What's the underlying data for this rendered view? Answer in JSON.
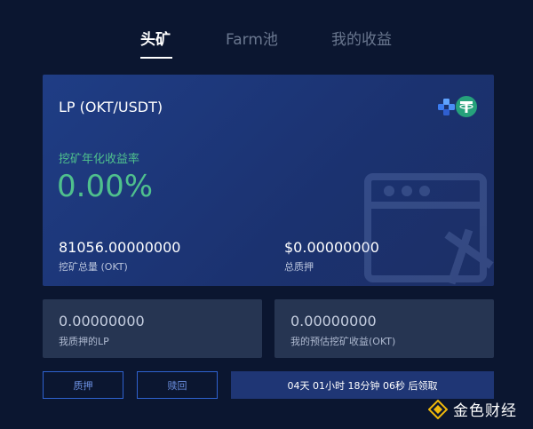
{
  "tabs": [
    {
      "label": "头矿",
      "active": true
    },
    {
      "label": "Farm池",
      "active": false
    },
    {
      "label": "我的收益",
      "active": false
    }
  ],
  "pool": {
    "title": "LP (OKT/USDT)",
    "token_icons": [
      "okt-token-icon",
      "usdt-token-icon"
    ],
    "apy_label": "挖矿年化收益率",
    "apy_value": "0.00%",
    "total_mined": {
      "value": "81056.00000000",
      "label": "挖矿总量 (OKT)"
    },
    "total_staked": {
      "value": "$0.00000000",
      "label": "总质押"
    }
  },
  "my_lp": {
    "value": "0.00000000",
    "label": "我质押的LP"
  },
  "my_estimated": {
    "value": "0.00000000",
    "label": "我的预估挖矿收益(OKT)"
  },
  "buttons": {
    "stake": "质押",
    "redeem": "赎回",
    "countdown": "04天 01小时 18分钟 06秒 后领取"
  },
  "brand": {
    "text": "金色财经"
  },
  "colors": {
    "background": "#0b1630",
    "card": "#1f3d85",
    "accent_green": "#4fc08d",
    "button_border": "#2f62d0",
    "countdown_bg": "#1f3675"
  }
}
